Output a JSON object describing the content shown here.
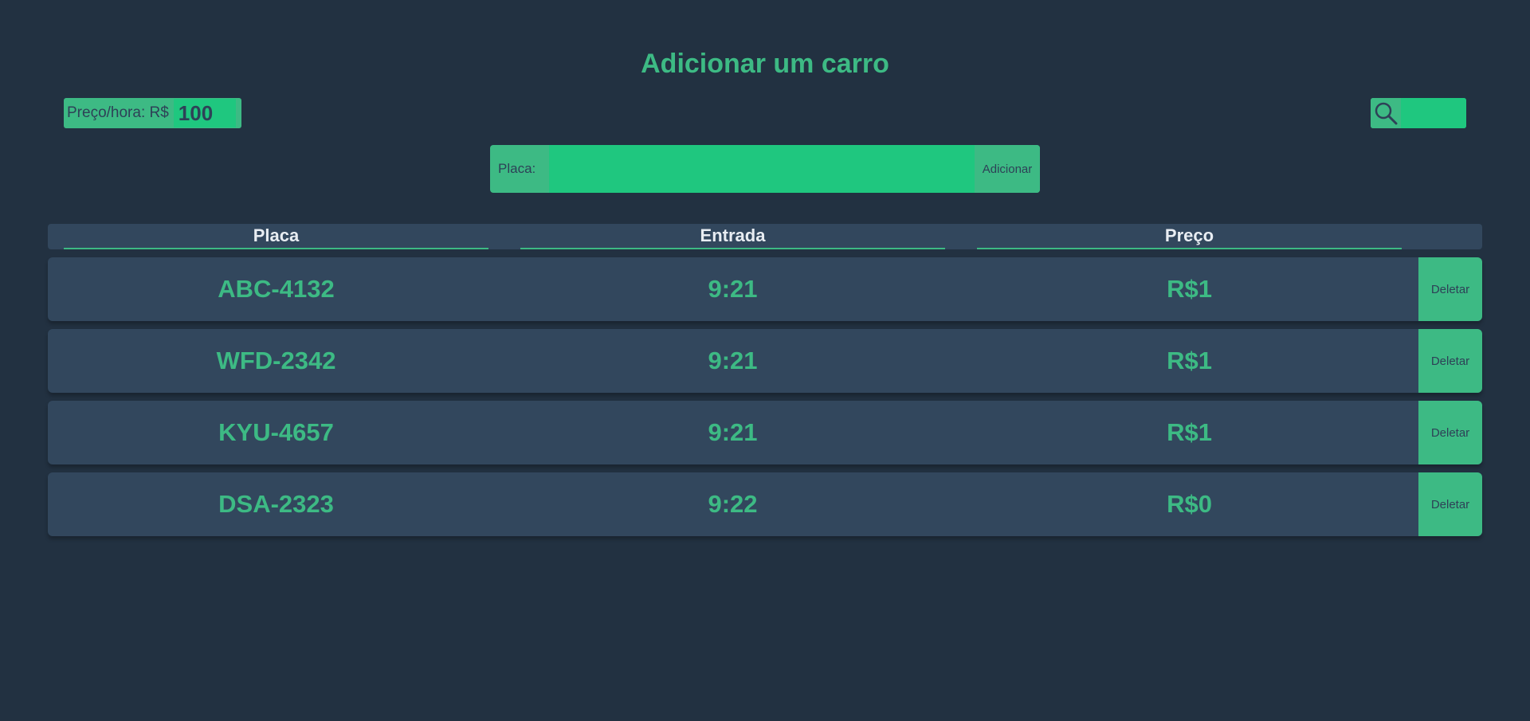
{
  "header": {
    "title": "Adicionar um carro"
  },
  "price": {
    "label": "Preço/hora: R$",
    "value": "100"
  },
  "search": {
    "icon": "search-icon",
    "value": ""
  },
  "add_form": {
    "plate_label": "Placa:",
    "plate_value": "",
    "add_label": "Adicionar"
  },
  "table": {
    "columns": [
      "Placa",
      "Entrada",
      "Preço"
    ],
    "rows": [
      {
        "placa": "ABC-4132",
        "entrada": "9:21",
        "preco": "R$1",
        "delete_label": "Deletar"
      },
      {
        "placa": "WFD-2342",
        "entrada": "9:21",
        "preco": "R$1",
        "delete_label": "Deletar"
      },
      {
        "placa": "KYU-4657",
        "entrada": "9:21",
        "preco": "R$1",
        "delete_label": "Deletar"
      },
      {
        "placa": "DSA-2323",
        "entrada": "9:22",
        "preco": "R$0",
        "delete_label": "Deletar"
      }
    ]
  },
  "colors": {
    "background": "#223141",
    "accent": "#3dba84",
    "input_fill": "#1fc77f",
    "row_background": "#32475d",
    "header_text": "#e8edf2"
  }
}
